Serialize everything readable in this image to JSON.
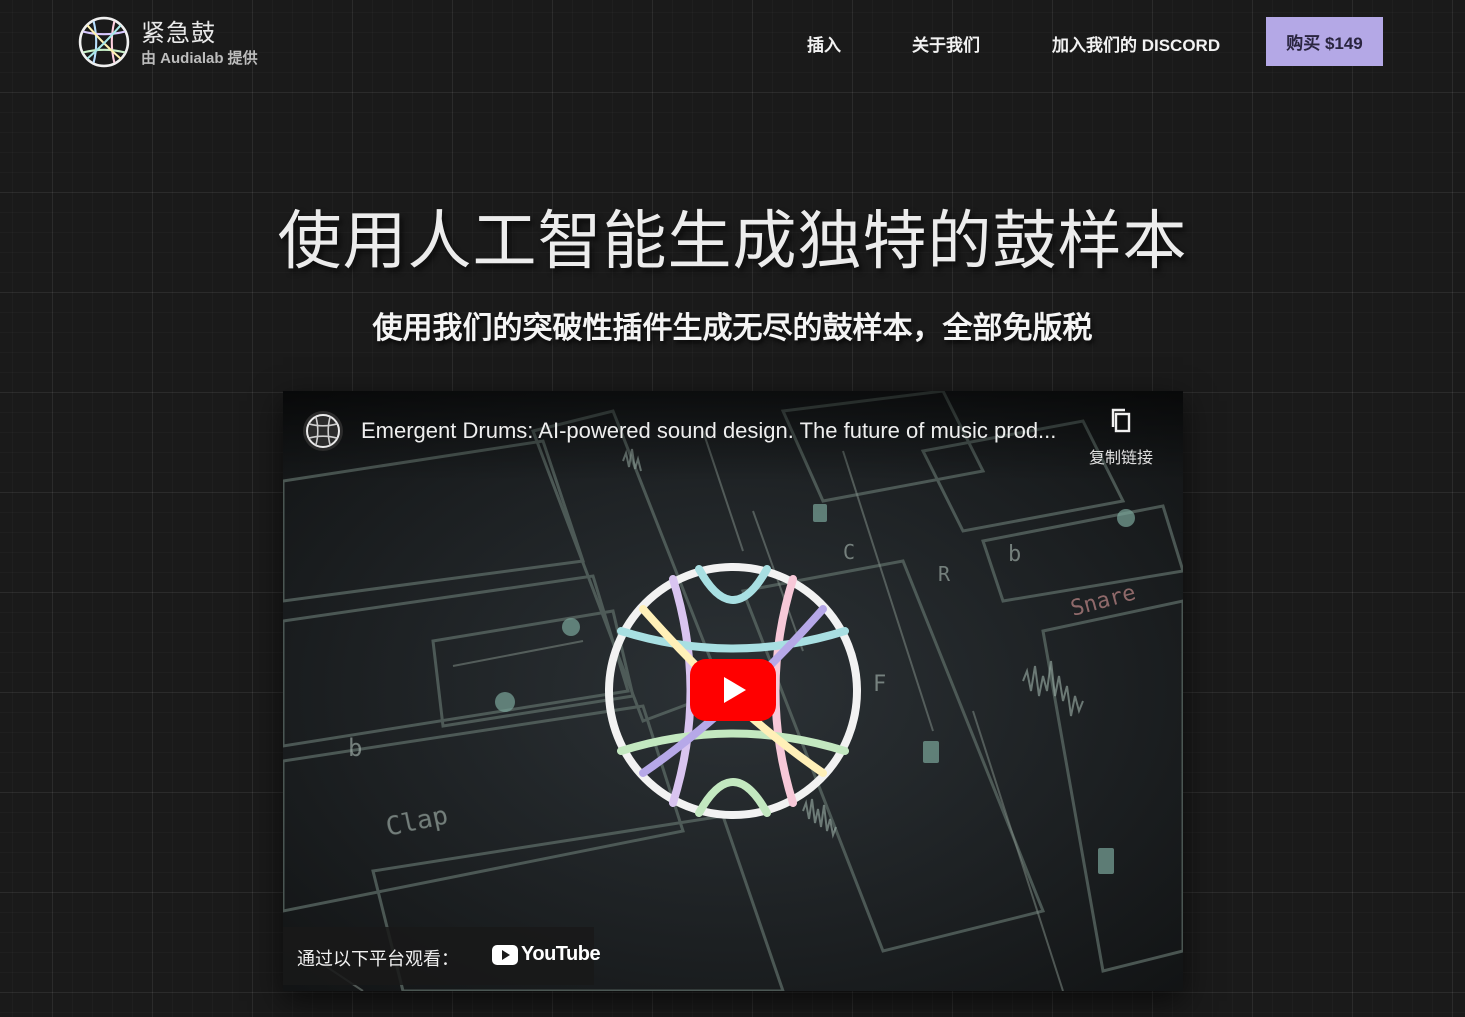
{
  "header": {
    "brand_title": "紧急鼓",
    "brand_subtitle": "由 Audialab 提供",
    "nav": [
      {
        "label": "插入"
      },
      {
        "label": "关于我们"
      },
      {
        "label": "加入我们的 DISCORD"
      }
    ],
    "buy_label": "购买 $149"
  },
  "hero": {
    "title": "使用人工智能生成独特的鼓样本",
    "subtitle": "使用我们的突破性插件生成无尽的鼓样本，全部免版税"
  },
  "video": {
    "title": "Emergent Drums: AI-powered sound design. The future of music prod...",
    "copy_link_label": "复制链接",
    "watch_on_label": "通过以下平台观看：",
    "platform": "YouTube",
    "icons": {
      "play": "play-button-icon",
      "copy": "copy-icon",
      "logo": "emergent-drums-logo"
    },
    "background_labels": [
      "Clap",
      "Snare",
      "b",
      "b",
      "C",
      "R",
      "F"
    ]
  },
  "colors": {
    "background": "#1a1a1a",
    "buy_button": "#b4a8e6",
    "youtube_red": "#ff0000"
  }
}
